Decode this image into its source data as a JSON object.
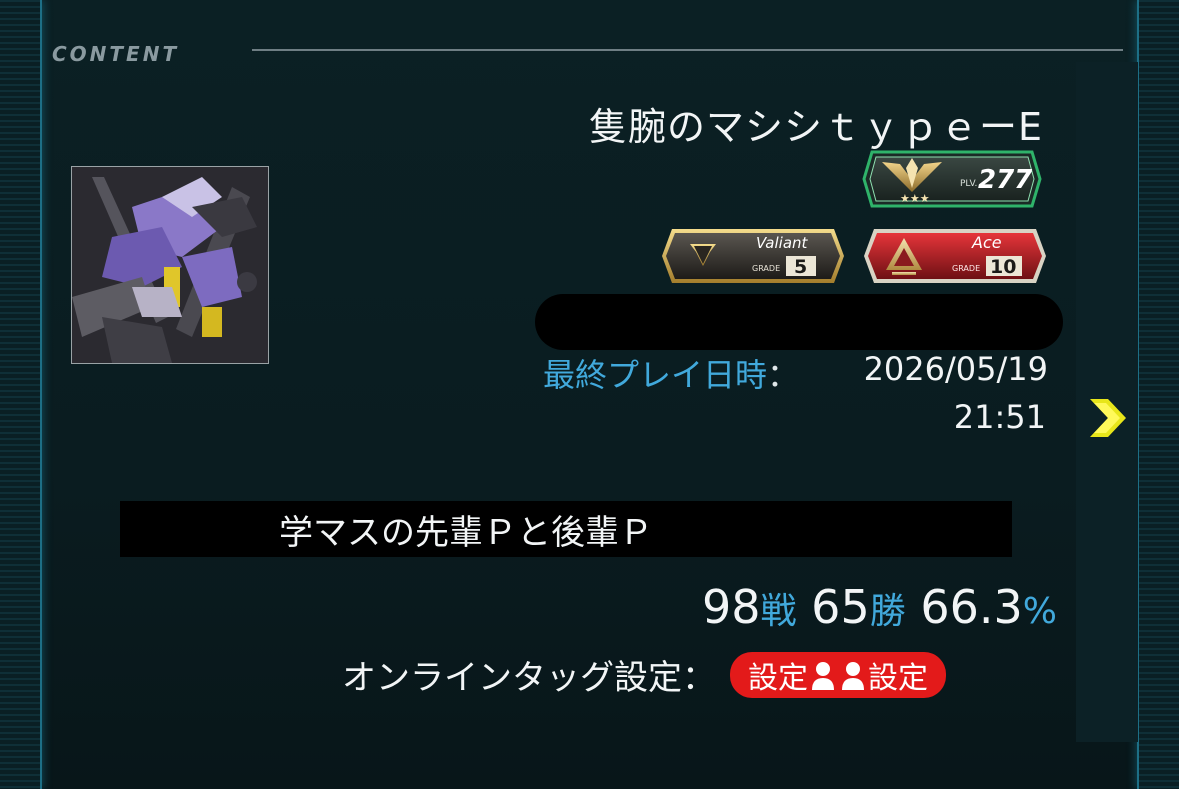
{
  "header": {
    "section_label": "CONTENT"
  },
  "profile": {
    "name": "隻腕のマシシｔｙｐｅーE",
    "level_badge": {
      "prefix": "PLV.",
      "value": "277",
      "stars": 3,
      "icon": "wing-emblem-icon"
    },
    "class_badges": [
      {
        "label": "Valiant",
        "grade_prefix": "GRADE",
        "grade": "5",
        "color": "#b8962a",
        "icon": "v-emblem-icon"
      },
      {
        "label": "Ace",
        "grade_prefix": "GRADE",
        "grade": "10",
        "color": "#c9252b",
        "icon": "ace-emblem-icon"
      }
    ],
    "last_play": {
      "label": "最終プレイ日時",
      "colon": "：",
      "date": "2026/05/19",
      "time": "21:51"
    }
  },
  "team": {
    "name": "学マスの先輩Ｐと後輩Ｐ",
    "battles": "98",
    "battles_unit": "戦",
    "wins": "65",
    "wins_unit": "勝",
    "rate": "66.3",
    "rate_unit": "%",
    "online_tag_label": "オンラインタッグ設定：",
    "online_tag_left": "設定",
    "online_tag_right": "設定",
    "online_tag_icon": "two-person-icon"
  },
  "nav": {
    "next_icon": "chevron-right-icon"
  },
  "colors": {
    "accent_blue": "#41a9dc",
    "tag_red": "#e31a1a",
    "level_green": "#2fb36a",
    "arrow_yellow": "#e8e61a"
  }
}
